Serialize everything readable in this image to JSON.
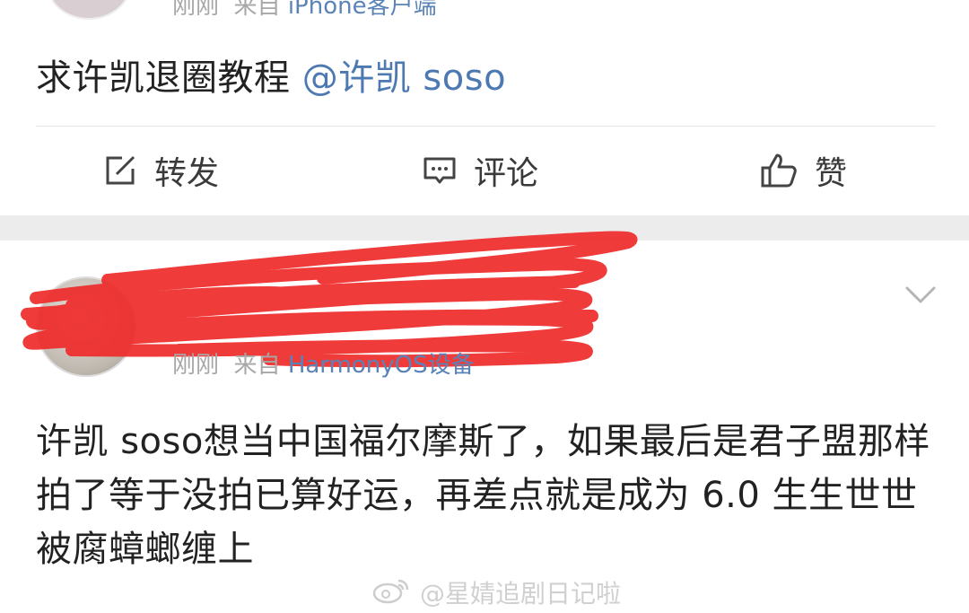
{
  "post1": {
    "meta_time": "刚刚",
    "meta_from": "来自",
    "meta_device": "iPhone客户端",
    "text": "求许凯退圈教程",
    "mention": "@许凯 soso"
  },
  "actions": {
    "repost": "转发",
    "comment": "评论",
    "like": "赞"
  },
  "post2": {
    "meta_time": "刚刚",
    "meta_from": "来自",
    "meta_device": "HarmonyOS设备",
    "text": "许凯 soso想当中国福尔摩斯了，如果最后是君子盟那样拍了等于没拍已算好运，再差点就是成为 6.0 生生世世被腐蟑螂缠上"
  },
  "watermark": {
    "text": "@星婧追剧日记啦"
  },
  "colors": {
    "link": "#4d79b3",
    "redaction": "#ef2b2b",
    "meta": "#a7a7a7"
  },
  "icons": [
    "repost-icon",
    "comment-icon",
    "like-icon",
    "chevron-down-icon",
    "weibo-logo-icon"
  ]
}
